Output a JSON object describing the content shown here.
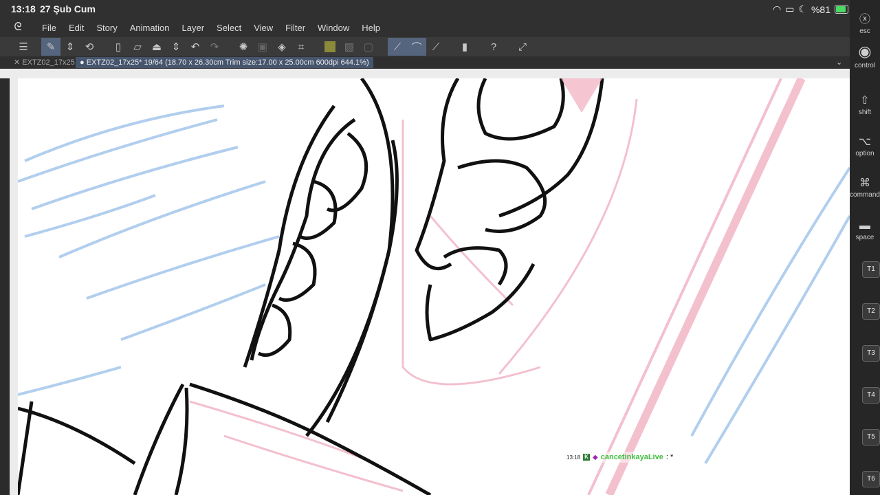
{
  "status_bar": {
    "time": "13:18",
    "date": "27 Şub Cum",
    "battery_pct": "%81",
    "icons": [
      "wifi-icon",
      "screen-mirror-icon",
      "moon-icon",
      "battery-icon"
    ]
  },
  "menu": {
    "items": [
      "File",
      "Edit",
      "Story",
      "Animation",
      "Layer",
      "Select",
      "View",
      "Filter",
      "Window",
      "Help"
    ]
  },
  "toolbar": {
    "icons": [
      "hamburger-menu-icon",
      "pen-pressure-icon",
      "up-down-chevron-icon",
      "rotate-view-icon",
      "new-canvas-icon",
      "open-folder-icon",
      "save-icon",
      "up-down-chevron-icon",
      "undo-icon",
      "redo-icon",
      "deselect-icon",
      "crop-icon",
      "invert-selection-icon",
      "transform-icon",
      "color-fill-icon",
      "clear-icon",
      "layer-icon",
      "pen-tool-icon",
      "brush-tool-icon",
      "eraser-tool-icon",
      "device-icon",
      "help-icon",
      "expand-icon"
    ]
  },
  "tabs": {
    "tab1": "EXTZ02_17x25",
    "tab2": "EXTZ02_17x25* 19/64 (18.70 x 26.30cm Trim size:17.00 x 25.00cm 600dpi 644.1%)",
    "dropdown_icon": "chevron-down-icon"
  },
  "side_keys": {
    "esc": "esc",
    "control": "control",
    "shift": "shift",
    "option": "option",
    "command": "command",
    "space": "space",
    "tkeys": [
      "T1",
      "T2",
      "T3",
      "T4",
      "T5",
      "T6"
    ]
  },
  "chat": {
    "time": "13:18",
    "user": "cancetinkayaLive",
    "message": ": *"
  }
}
